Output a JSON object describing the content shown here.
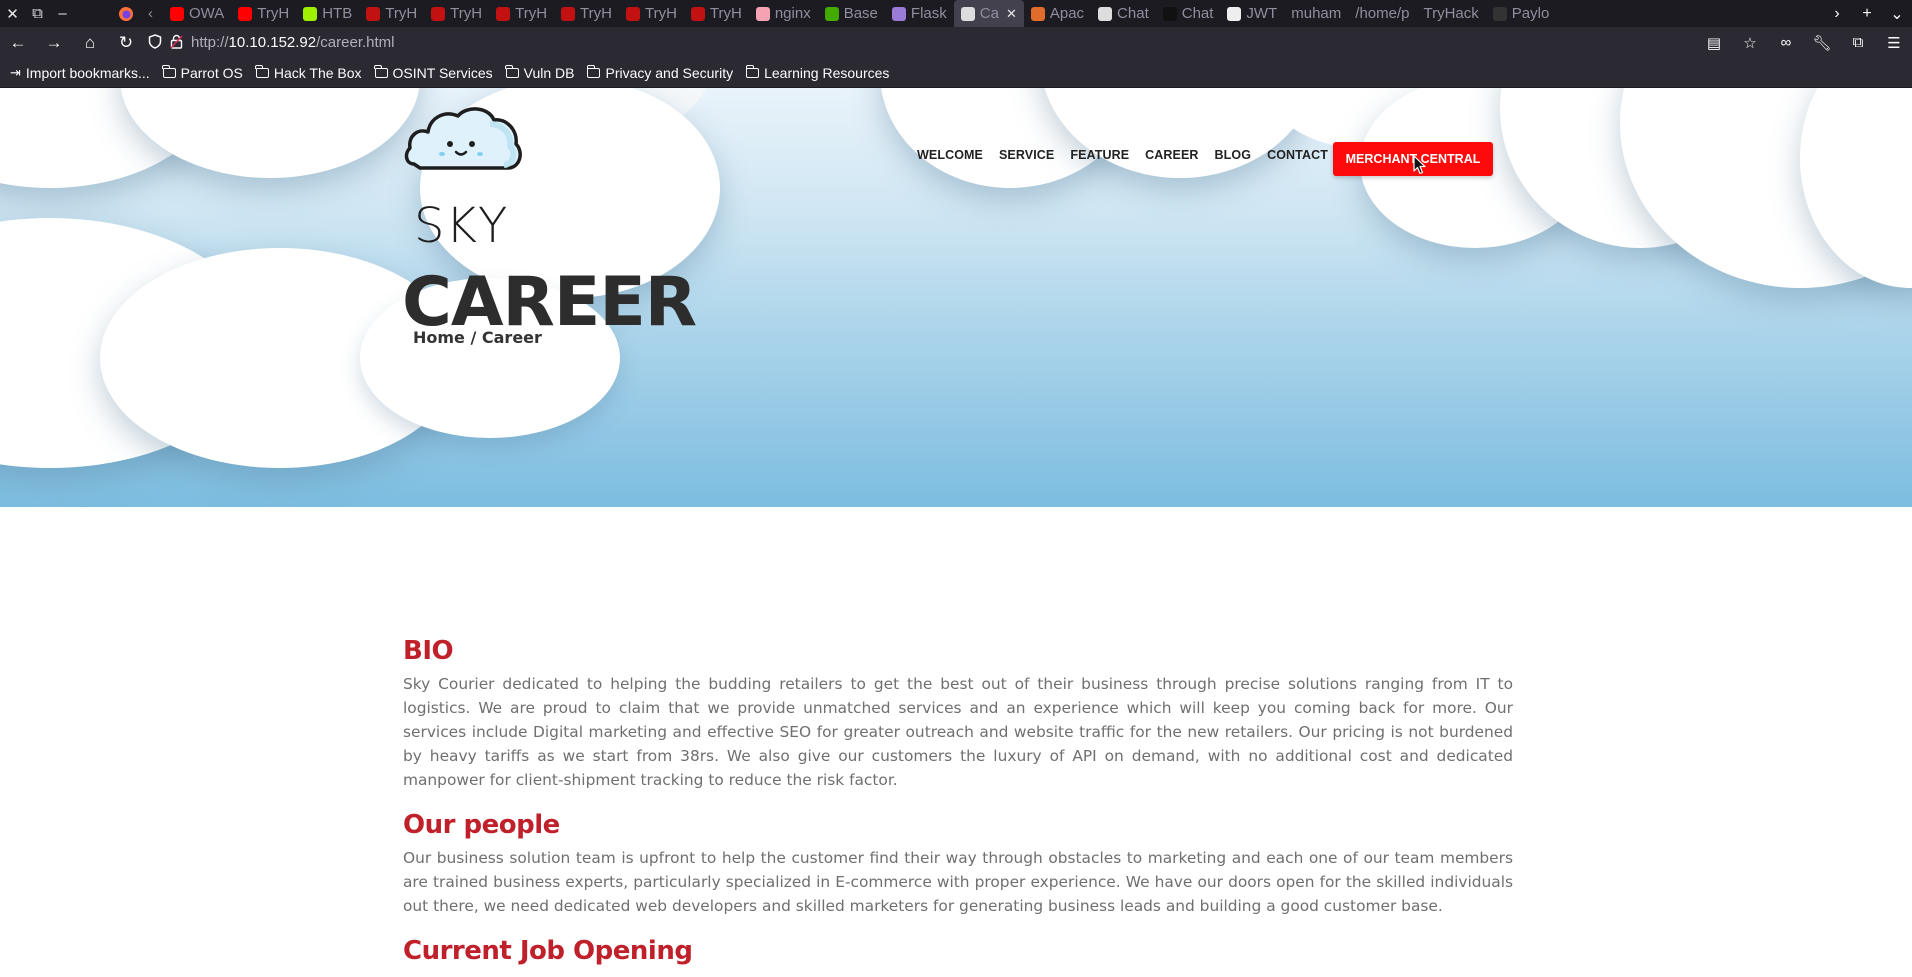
{
  "browser": {
    "tabs": [
      {
        "label": "OWA",
        "favicon_color": "#ff0000"
      },
      {
        "label": "TryH",
        "favicon_color": "#ff0000"
      },
      {
        "label": "HTB",
        "favicon_color": "#9fef00"
      },
      {
        "label": "TryH",
        "favicon_color": "#c11111"
      },
      {
        "label": "TryH",
        "favicon_color": "#c11111"
      },
      {
        "label": "TryH",
        "favicon_color": "#c11111"
      },
      {
        "label": "TryH",
        "favicon_color": "#c11111"
      },
      {
        "label": "TryH",
        "favicon_color": "#c11111"
      },
      {
        "label": "TryH",
        "favicon_color": "#c11111"
      },
      {
        "label": "nginx",
        "favicon_color": "#f5a3b3"
      },
      {
        "label": "Base",
        "favicon_color": "#44aa00"
      },
      {
        "label": "Flask",
        "favicon_color": "#9b7bd8"
      },
      {
        "label": "Ca",
        "favicon_color": "#dddddd",
        "active": true
      },
      {
        "label": "Apac",
        "favicon_color": "#e06b2b"
      },
      {
        "label": "Chat",
        "favicon_color": "#dddddd"
      },
      {
        "label": "Chat",
        "favicon_color": "#111111"
      },
      {
        "label": "JWT",
        "favicon_color": "#eeeeee"
      },
      {
        "label": "muham",
        "favicon_color": ""
      },
      {
        "label": "/home/p",
        "favicon_color": ""
      },
      {
        "label": "TryHack",
        "favicon_color": ""
      },
      {
        "label": "Paylo",
        "favicon_color": "#333333"
      }
    ],
    "url_prefix": "http://",
    "url_host": "10.10.152.92",
    "url_path": "/career.html",
    "bookmarks": [
      {
        "label": "Import bookmarks...",
        "icon": "import-icon"
      },
      {
        "label": "Parrot OS",
        "icon": "folder-icon"
      },
      {
        "label": "Hack The Box",
        "icon": "folder-icon"
      },
      {
        "label": "OSINT Services",
        "icon": "folder-icon"
      },
      {
        "label": "Vuln DB",
        "icon": "folder-icon"
      },
      {
        "label": "Privacy and Security",
        "icon": "folder-icon"
      },
      {
        "label": "Learning Resources",
        "icon": "folder-icon"
      }
    ]
  },
  "site": {
    "logo_word": "SKY",
    "nav": [
      "WELCOME",
      "SERVICE",
      "FEATURE",
      "CAREER",
      "BLOG",
      "CONTACT"
    ],
    "merchant_button": "MERCHANT CENTRAL",
    "hero_title": "CAREER",
    "breadcrumb": "Home / Career",
    "sections": [
      {
        "heading": "BIO",
        "body": "Sky Courier dedicated to helping the budding retailers to get the best out of their business through precise solutions ranging from IT to logistics. We are proud to claim that we provide unmatched services and an experience which will keep you coming back for more. Our services include Digital marketing and effective SEO for greater outreach and website traffic for the new retailers. Our pricing is not burdened by heavy tariffs as we start from 38rs. We also give our customers the luxury of API on demand, with no additional cost and dedicated manpower for client-shipment tracking to reduce the risk factor."
      },
      {
        "heading": "Our people",
        "body": "Our business solution team is upfront to help the customer find their way through obstacles to marketing and each one of our team members are trained business experts, particularly specialized in E-commerce with proper experience. We have our doors open for the skilled individuals out there, we need dedicated web developers and skilled marketers for generating business leads and building a good customer base."
      },
      {
        "heading": "Current Job Opening",
        "body": ""
      }
    ],
    "colors": {
      "accent_red": "#c0202a",
      "button_red": "#ff0a0a",
      "sky_blue": "#7dbde0"
    }
  }
}
